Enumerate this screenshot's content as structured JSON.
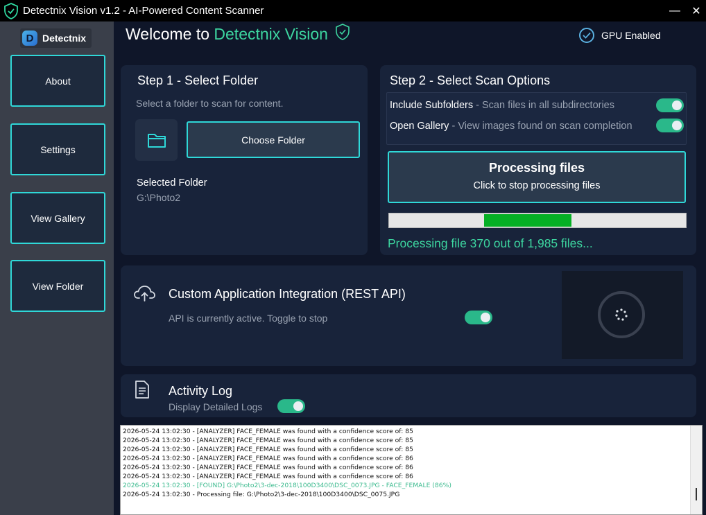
{
  "window": {
    "title": "Detectnix Vision v1.2 - AI-Powered Content Scanner",
    "minimize_glyph": "—",
    "close_glyph": "✕"
  },
  "sidebar": {
    "logo_letter": "D",
    "logo_text": "Detectnix",
    "items": [
      {
        "label": "About"
      },
      {
        "label": "Settings"
      },
      {
        "label": "View Gallery"
      },
      {
        "label": "View Folder"
      }
    ]
  },
  "header": {
    "welcome": "Welcome to ",
    "app_name": "Detectnix Vision",
    "gpu_status": "GPU Enabled"
  },
  "step1": {
    "title": "Step 1 - Select Folder",
    "subtitle": "Select a folder to scan for content.",
    "choose_label": "Choose Folder",
    "selected_label": "Selected Folder",
    "selected_path": "G:\\Photo2"
  },
  "step2": {
    "title": "Step 2 - Select Scan Options",
    "options": [
      {
        "name": "Include Subfolders",
        "desc": " - Scan files in all subdirectories",
        "enabled": true
      },
      {
        "name": "Open Gallery",
        "desc": " - View images found on scan completion",
        "enabled": true
      }
    ],
    "processing_title": "Processing files",
    "processing_sub": "Click to stop processing files",
    "progress_fraction": 0.186,
    "progress_text": "Processing file 370 out of 1,985 files..."
  },
  "api": {
    "title": "Custom Application Integration (REST API)",
    "status": "API is currently active. Toggle to stop",
    "enabled": true
  },
  "activity": {
    "title": "Activity Log",
    "detailed_label": "Display Detailed Logs",
    "detailed_enabled": true,
    "lines": [
      {
        "text": "2026-05-24 13:02:30 - [ANALYZER] FACE_FEMALE was found with a confidence score of: 85",
        "kind": "normal"
      },
      {
        "text": "2026-05-24 13:02:30 - [ANALYZER] FACE_FEMALE was found with a confidence score of: 85",
        "kind": "normal"
      },
      {
        "text": "2026-05-24 13:02:30 - [ANALYZER] FACE_FEMALE was found with a confidence score of: 85",
        "kind": "normal"
      },
      {
        "text": "2026-05-24 13:02:30 - [ANALYZER] FACE_FEMALE was found with a confidence score of: 86",
        "kind": "normal"
      },
      {
        "text": "2026-05-24 13:02:30 - [ANALYZER] FACE_FEMALE was found with a confidence score of: 86",
        "kind": "normal"
      },
      {
        "text": "2026-05-24 13:02:30 - [ANALYZER] FACE_FEMALE was found with a confidence score of: 86",
        "kind": "normal"
      },
      {
        "text": "2026-05-24 13:02:30 - [FOUND] G:\\Photo2\\3-dec-2018\\100D3400\\DSC_0073.JPG - FACE_FEMALE (86%)",
        "kind": "found"
      },
      {
        "text": "2026-05-24 13:02:30 - Processing file: G:\\Photo2\\3-dec-2018\\100D3400\\DSC_0075.JPG",
        "kind": "normal"
      }
    ]
  },
  "colors": {
    "accent": "#3dd6a0",
    "button_border": "#2fd8d8",
    "toggle_on": "#2ab88a",
    "progress_fill": "#06b025"
  }
}
